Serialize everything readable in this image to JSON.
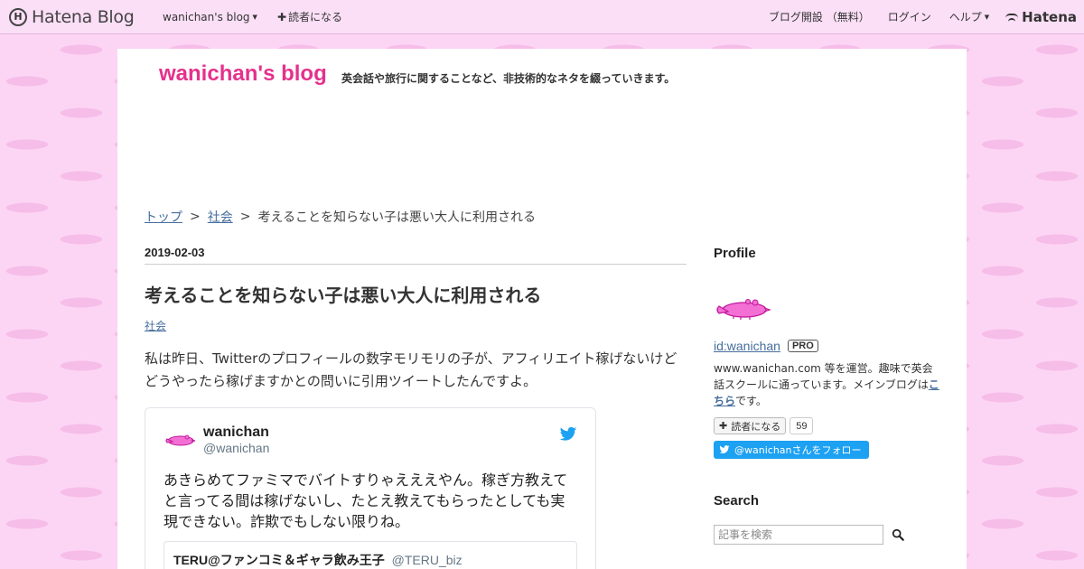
{
  "globalheader": {
    "logo_mark": "H",
    "logo_text": "Hatena Blog",
    "blog_menu": "wanichan's blog",
    "subscribe": "読者になる",
    "start_blog": "ブログ開設 （無料）",
    "login": "ログイン",
    "help": "ヘルプ",
    "hatena": "Hatena"
  },
  "blog": {
    "title": "wanichan's blog",
    "description": "英会話や旅行に関することなど、非技術的なネタを綴っていきます。"
  },
  "breadcrumb": {
    "top": "トップ",
    "category": "社会",
    "current": "考えることを知らない子は悪い大人に利用される",
    "sep": ">"
  },
  "entry": {
    "date": "2019-02-03",
    "title": "考えることを知らない子は悪い大人に利用される",
    "category": "社会",
    "body": "私は昨日、Twitterのプロフィールの数字モリモリの子が、アフィリエイト稼げないけどどうやったら稼げますかとの問いに引用ツイートしたんですよ。"
  },
  "tweet": {
    "name": "wanichan",
    "handle": "@wanichan",
    "text": "あきらめてファミマでバイトすりゃえええやん。稼ぎ方教えてと言ってる間は稼げないし、たとえ教えてもらったとしても実現できない。詐欺でもしない限りね。",
    "quote_name": "TERU@ファンコミ＆ギャラ飲み王子",
    "quote_handle": "@TERU_biz"
  },
  "sidebar": {
    "profile_heading": "Profile",
    "profile_id": "id:wanichan",
    "pro_badge": "PRO",
    "desc_prefix": "www.wanichan.com 等を運営。趣味で英会話スクールに通っています。メインブログは",
    "desc_link": "こちら",
    "desc_suffix": "です。",
    "subscribe_label": "読者になる",
    "subscribe_count": "59",
    "follow_label": "@wanichanさんをフォロー",
    "search_heading": "Search",
    "search_placeholder": "記事を検索"
  },
  "colors": {
    "background": "#fcd5f4",
    "title": "#e5318c",
    "link": "#456d9c",
    "twitter": "#1da1f2"
  }
}
